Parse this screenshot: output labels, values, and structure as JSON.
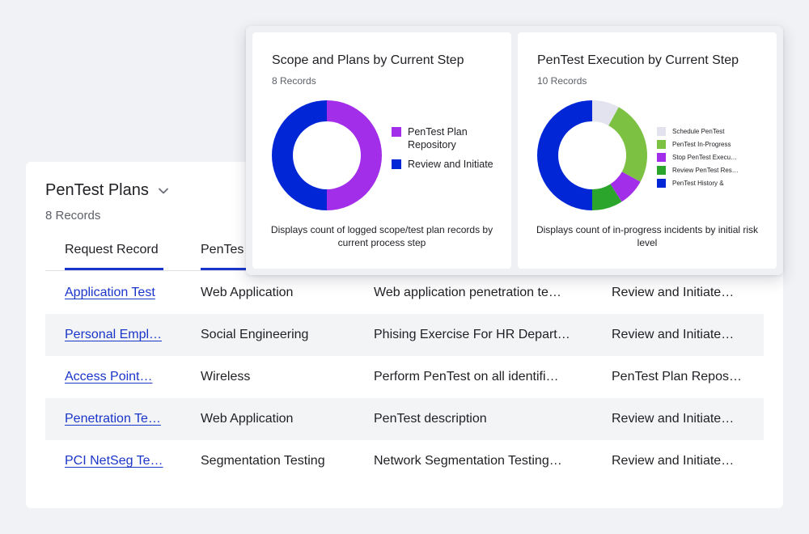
{
  "list": {
    "title": "PenTest Plans",
    "count": "8 Records",
    "columns": [
      "Request Record",
      "PenTes"
    ],
    "rows": [
      [
        "Application Test",
        "Web Application",
        "Web application penetration te…",
        "Review and Initiate…"
      ],
      [
        "Personal Empl…",
        "Social Engineering",
        "Phising Exercise For HR Depart…",
        "Review and Initiate…"
      ],
      [
        "Access Point…",
        "Wireless",
        "Perform PenTest on all identifi…",
        "PenTest Plan Repos…"
      ],
      [
        "Penetration Te…",
        "Web Application",
        "PenTest description",
        "Review and Initiate…"
      ],
      [
        "PCI NetSeg Te…",
        "Segmentation Testing",
        "Network Segmentation Testing…",
        "Review and Initiate…"
      ]
    ]
  },
  "charts": {
    "scope": {
      "title": "Scope and Plans by Current Step",
      "count": "8 Records",
      "description": "Displays count of logged scope/test plan records by current process step",
      "legend": [
        {
          "label": "PenTest Plan Repository",
          "color": "#a22eea"
        },
        {
          "label": "Review and Initiate",
          "color": "#0026d6"
        }
      ]
    },
    "execution": {
      "title": "PenTest Execution by Current Step",
      "count": "10 Records",
      "description": "Displays count of in-progress incidents by initial risk level",
      "legend": [
        {
          "label": "Schedule PenTest",
          "color": "#e2e3ee"
        },
        {
          "label": "PenTest In-Progress",
          "color": "#7dc142"
        },
        {
          "label": "Stop PenTest Execu…",
          "color": "#a22eea"
        },
        {
          "label": "Review PenTest Res…",
          "color": "#2ca52c"
        },
        {
          "label": "PenTest History &",
          "color": "#0026d6"
        }
      ]
    }
  },
  "chart_data": [
    {
      "type": "pie",
      "title": "Scope and Plans by Current Step",
      "subtitle": "8 Records",
      "categories": [
        "PenTest Plan Repository",
        "Review and Initiate"
      ],
      "values": [
        4,
        4
      ],
      "colors": [
        "#a22eea",
        "#0026d6"
      ],
      "donut": true,
      "legend": "right"
    },
    {
      "type": "pie",
      "title": "PenTest Execution by Current Step",
      "subtitle": "10 Records",
      "categories": [
        "Schedule PenTest",
        "PenTest In-Progress",
        "Stop PenTest Execu…",
        "Review PenTest Res…",
        "PenTest History &"
      ],
      "values": [
        0.8,
        2.5,
        0.8,
        0.9,
        5
      ],
      "colors": [
        "#e2e3ee",
        "#7dc142",
        "#a22eea",
        "#2ca52c",
        "#0026d6"
      ],
      "donut": true,
      "legend": "right"
    }
  ]
}
